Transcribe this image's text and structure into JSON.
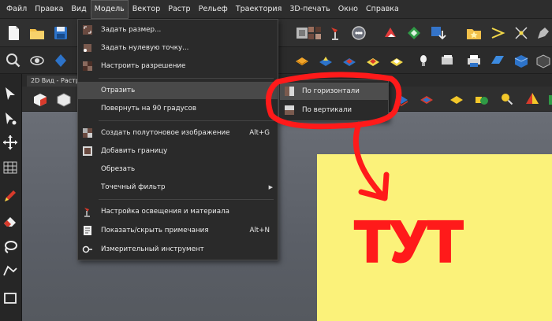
{
  "menubar": {
    "items": [
      "Файл",
      "Правка",
      "Вид",
      "Модель",
      "Вектор",
      "Растр",
      "Рельеф",
      "Траектория",
      "3D-печать",
      "Окно",
      "Справка"
    ]
  },
  "document_tab": {
    "label": "2D Вид - Растр"
  },
  "model_menu": {
    "items": [
      {
        "label": "Задать размер...",
        "shortcut": "",
        "icon": "resize-icon"
      },
      {
        "label": "Задать нулевую точку...",
        "shortcut": "",
        "icon": "origin-point-icon"
      },
      {
        "label": "Настроить разрешение",
        "shortcut": "",
        "icon": "resolution-icon"
      },
      {
        "label": "Отразить",
        "shortcut": "",
        "icon": "none",
        "submenu": true
      },
      {
        "label": "Повернуть на 90 градусов",
        "shortcut": "",
        "icon": "none"
      },
      {
        "label": "Создать полутоновое изображение",
        "shortcut": "Alt+G",
        "icon": "grayscale-icon"
      },
      {
        "label": "Добавить границу",
        "shortcut": "",
        "icon": "border-icon"
      },
      {
        "label": "Обрезать",
        "shortcut": "",
        "icon": "none"
      },
      {
        "label": "Точечный фильтр",
        "shortcut": "",
        "icon": "none",
        "submenu": true
      },
      {
        "label": "Настройка освещения и материала",
        "shortcut": "",
        "icon": "lamp-icon"
      },
      {
        "label": "Показать/скрыть примечания",
        "shortcut": "Alt+N",
        "icon": "notes-icon"
      },
      {
        "label": "Измерительный инструмент",
        "shortcut": "",
        "icon": "measure-icon"
      }
    ]
  },
  "mirror_submenu": {
    "items": [
      {
        "label": "По горизонтали",
        "icon": "mirror-horizontal-icon"
      },
      {
        "label": "По вертикали",
        "icon": "mirror-vertical-icon"
      }
    ]
  },
  "annotation": {
    "text": "ТУТ",
    "color": "#ff1a1a"
  },
  "colors": {
    "sheet": "#fbf27a",
    "menu_bg": "#2a2a2a",
    "menubar_bg": "#2d2d2d"
  }
}
